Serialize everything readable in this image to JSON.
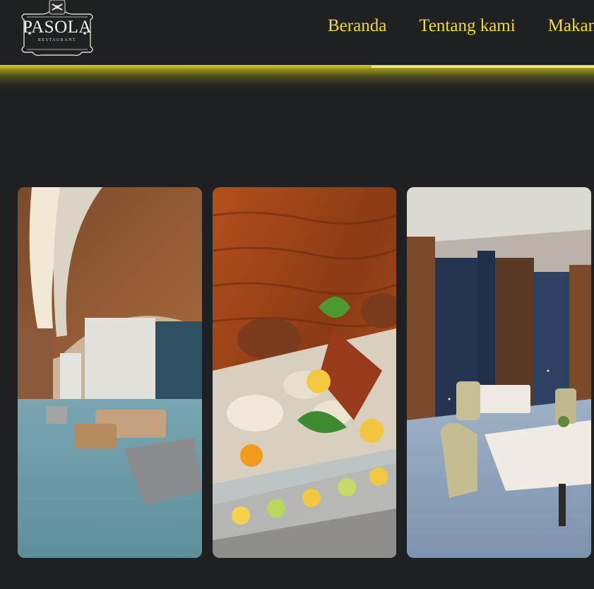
{
  "brand": {
    "name": "PASOLA",
    "subtitle": "RESTAURANT"
  },
  "nav": {
    "items": [
      "Beranda",
      "Tentang kami",
      "Makanan"
    ]
  },
  "colors": {
    "background": "#1f2021",
    "nav_text": "#f5da28",
    "accent_glow": "#d6d215"
  },
  "gallery": [
    {
      "subject": "lounge-interior"
    },
    {
      "subject": "seafood-platter"
    },
    {
      "subject": "dining-room"
    }
  ]
}
